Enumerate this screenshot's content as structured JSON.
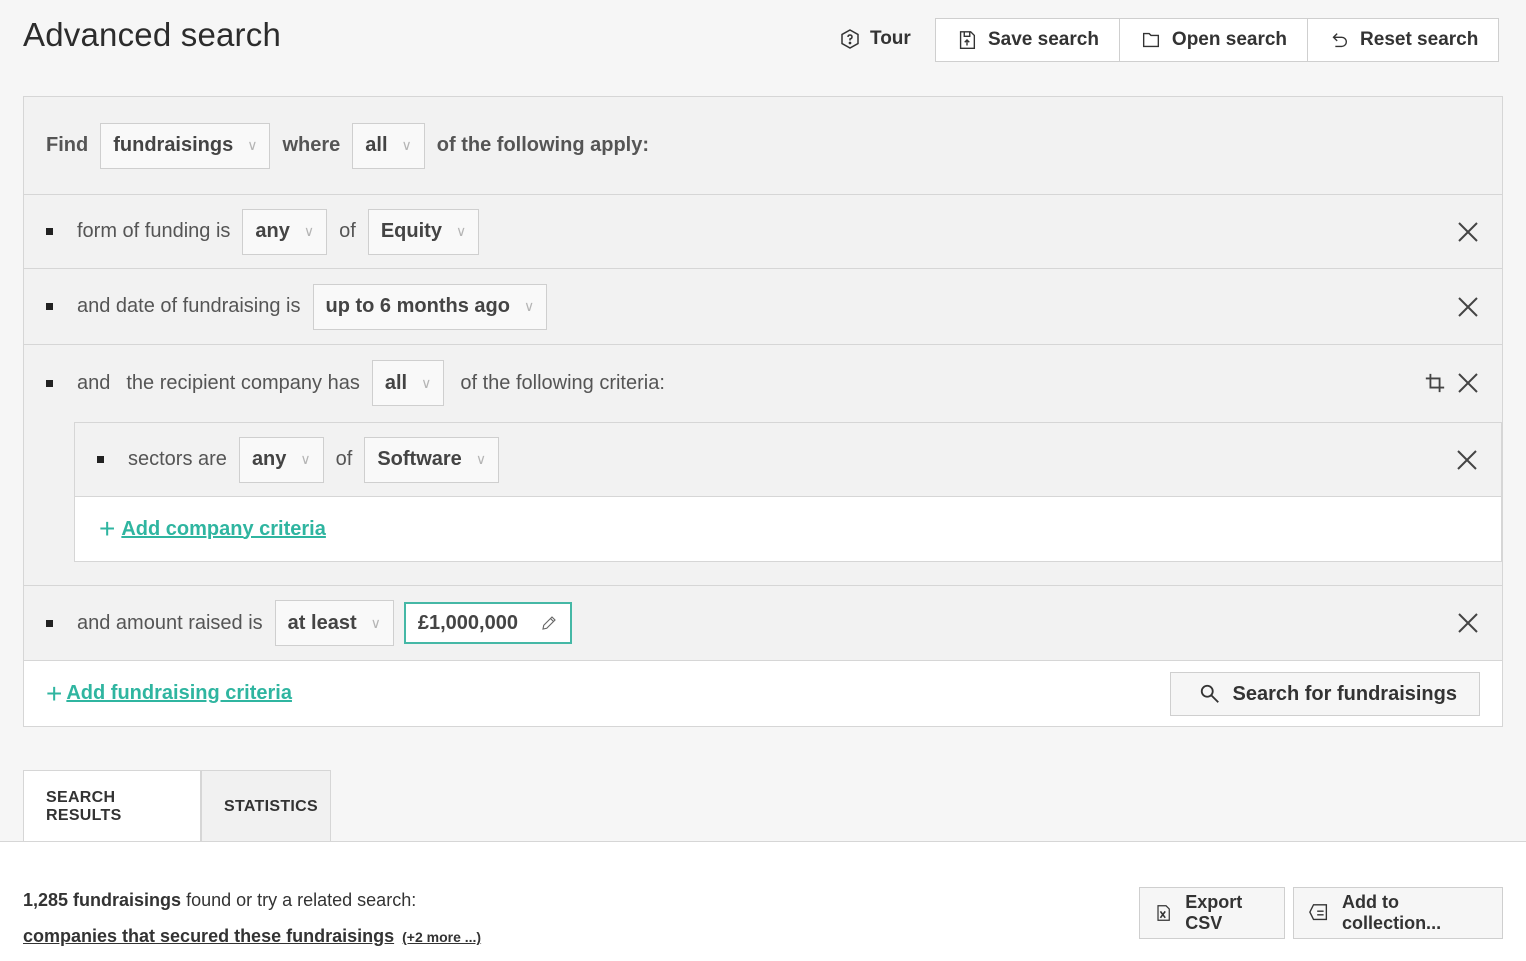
{
  "header": {
    "title": "Advanced search",
    "tour_label": "Tour",
    "save_label": "Save search",
    "open_label": "Open search",
    "reset_label": "Reset search"
  },
  "query": {
    "find_label": "Find",
    "entity": "fundraisings",
    "where_label": "where",
    "match": "all",
    "apply_label": "of the following apply:"
  },
  "criteria": {
    "funding": {
      "label": "form of funding is",
      "op": "any",
      "of": "of",
      "value": "Equity"
    },
    "date": {
      "label": "and date of fundraising is",
      "value": "up to 6 months ago"
    },
    "company": {
      "and": "and",
      "label": "the recipient company has",
      "op": "all",
      "suffix": "of the following criteria:"
    },
    "sectors": {
      "label": "sectors are",
      "op": "any",
      "of": "of",
      "value": "Software"
    },
    "add_company": "Add company criteria",
    "amount": {
      "label": "and amount raised is",
      "op": "at least",
      "value": "£1,000,000"
    },
    "add_fundraising": "Add fundraising criteria"
  },
  "search_button": "Search for fundraisings",
  "tabs": [
    {
      "label": "SEARCH RESULTS",
      "active": true
    },
    {
      "label": "STATISTICS",
      "active": false
    }
  ],
  "results": {
    "count": "1,285 fundraisings",
    "count_suffix": "found or try a related search:",
    "related_link": "companies that secured these fundraisings",
    "more_link": "(+2 more ...)",
    "export_label": "Export CSV",
    "collection_label": "Add to collection..."
  },
  "colors": {
    "accent": "#2fb5a0",
    "background": "#f6f6f6"
  },
  "icons": [
    "tour-icon",
    "save-icon",
    "folder-icon",
    "reset-icon",
    "close-icon",
    "crop-icon",
    "pencil-icon",
    "search-icon",
    "excel-icon",
    "collection-icon"
  ]
}
